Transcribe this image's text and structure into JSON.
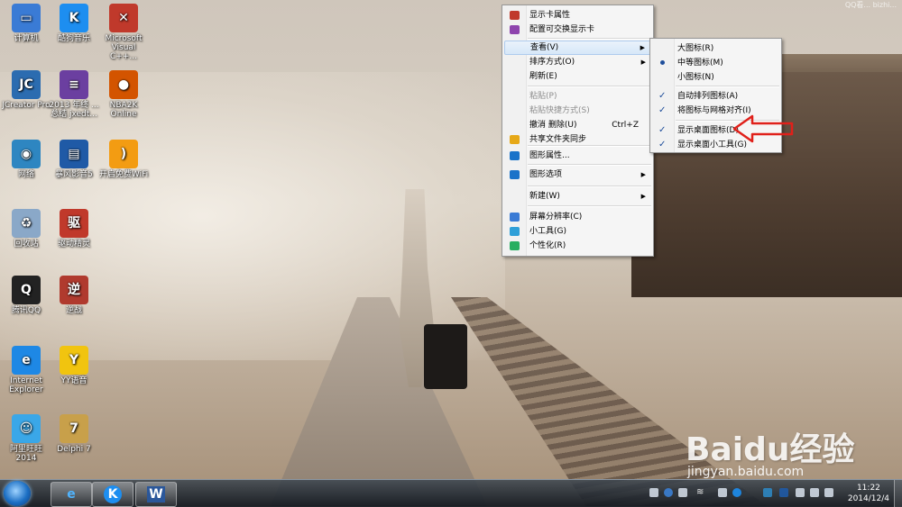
{
  "desktop": {
    "icons": [
      {
        "label": "计算机",
        "icon": "computer-icon",
        "color": "#3a7bd5",
        "glyph": "▭"
      },
      {
        "label": "酷狗音乐",
        "icon": "kugou-icon",
        "color": "#1d8ef0",
        "glyph": "K"
      },
      {
        "label": "Microsoft Visual C++...",
        "icon": "visual-cpp-icon",
        "color": "#c0392b",
        "glyph": "✕"
      },
      {
        "label": "JCreator Pro",
        "icon": "jcreator-icon",
        "color": "#2b6cb0",
        "glyph": "JC"
      },
      {
        "label": "2013 年终 ...总结 jxedt...",
        "icon": "winrar-icon",
        "color": "#6b3fa0",
        "glyph": "≡"
      },
      {
        "label": "NBA2K Online",
        "icon": "nba2k-icon",
        "color": "#d35400",
        "glyph": "●"
      },
      {
        "label": "网络",
        "icon": "network-icon",
        "color": "#2e86c1",
        "glyph": "◉"
      },
      {
        "label": "暴风影音5",
        "icon": "baofeng-icon",
        "color": "#1f5aa6",
        "glyph": "▤"
      },
      {
        "label": "开启免费WiFi",
        "icon": "wifi-icon",
        "color": "#f39c12",
        "glyph": ")"
      },
      {
        "label": "回收站",
        "icon": "recycle-bin-icon",
        "color": "#8aa8c8",
        "glyph": "♻"
      },
      {
        "label": "驱动精灵",
        "icon": "driver-genius-icon",
        "color": "#c0392b",
        "glyph": "驱"
      },
      {
        "label": "腾讯QQ",
        "icon": "qq-icon",
        "color": "#222222",
        "glyph": "Q"
      },
      {
        "label": "逆战",
        "icon": "nizhan-icon",
        "color": "#b03a2e",
        "glyph": "逆"
      },
      {
        "label": "Internet Explorer",
        "icon": "ie-icon",
        "color": "#1e88e5",
        "glyph": "e"
      },
      {
        "label": "YY语音",
        "icon": "yy-icon",
        "color": "#f1c40f",
        "glyph": "Y"
      },
      {
        "label": "阿里旺旺 2014",
        "icon": "aliwangwang-icon",
        "color": "#3aa7e8",
        "glyph": "☺"
      },
      {
        "label": "Delphi 7",
        "icon": "delphi-icon",
        "color": "#c8a04a",
        "glyph": "7"
      }
    ]
  },
  "context_menu": {
    "items": [
      {
        "label": "显示卡属性",
        "icon": "display-card-icon",
        "color": "#c0392b"
      },
      {
        "label": "配置可交换显示卡",
        "icon": "switchable-gpu-icon",
        "color": "#8e44ad"
      },
      {
        "label": "查看(V)"
      },
      {
        "label": "排序方式(O)"
      },
      {
        "label": "刷新(E)"
      },
      {
        "label": "粘贴(P)"
      },
      {
        "label": "粘贴快捷方式(S)"
      },
      {
        "label": "撤消 删除(U)",
        "accel": "Ctrl+Z"
      },
      {
        "label": "共享文件夹同步",
        "icon": "sync-folder-icon",
        "color": "#e6a817"
      },
      {
        "label": "图形属性...",
        "icon": "intel-icon",
        "color": "#1a73c9"
      },
      {
        "label": "图形选项",
        "icon": "intel-icon",
        "color": "#1a73c9"
      },
      {
        "label": "新建(W)"
      },
      {
        "label": "屏幕分辨率(C)",
        "icon": "screen-resolution-icon",
        "color": "#3a7bd5"
      },
      {
        "label": "小工具(G)",
        "icon": "gadgets-icon",
        "color": "#2f9fd8"
      },
      {
        "label": "个性化(R)",
        "icon": "personalize-icon",
        "color": "#27ae60"
      }
    ]
  },
  "view_submenu": {
    "items": [
      {
        "label": "大图标(R)"
      },
      {
        "label": "中等图标(M)"
      },
      {
        "label": "小图标(N)"
      },
      {
        "label": "自动排列图标(A)"
      },
      {
        "label": "将图标与网格对齐(I)"
      },
      {
        "label": "显示桌面图标(D)"
      },
      {
        "label": "显示桌面小工具(G)"
      }
    ]
  },
  "taskbar": {
    "pinned": [
      {
        "name": "ie-taskbar-button",
        "glyph": "e"
      },
      {
        "name": "kugou-taskbar-button",
        "glyph": "K"
      },
      {
        "name": "word-taskbar-button",
        "glyph": "W"
      }
    ],
    "clock_time": "11:22",
    "clock_date": "2014/12/4"
  },
  "watermark": {
    "brand": "Baidu经验",
    "url": "jingyan.baidu.com"
  },
  "corner_text": "QQ看...  bizhi..."
}
